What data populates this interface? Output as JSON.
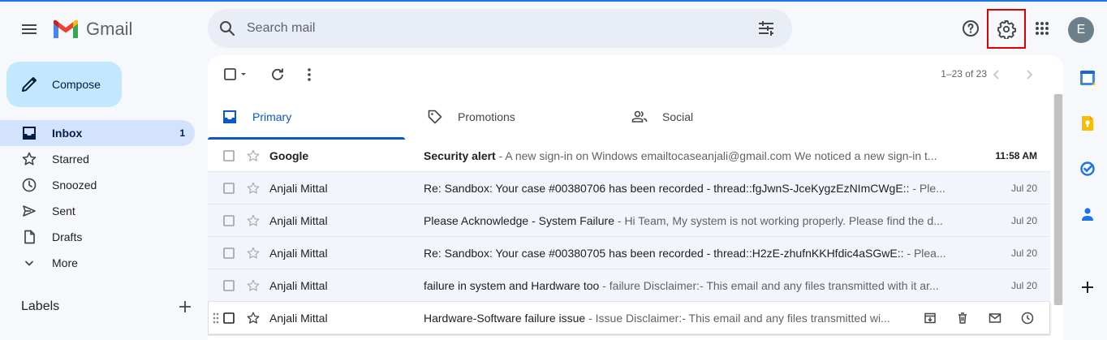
{
  "app": {
    "title": "Gmail"
  },
  "search": {
    "placeholder": "Search mail"
  },
  "account": {
    "initial": "E"
  },
  "compose": {
    "label": "Compose"
  },
  "nav": {
    "items": [
      {
        "label": "Inbox",
        "count": "1",
        "icon": "inbox-icon"
      },
      {
        "label": "Starred",
        "count": "",
        "icon": "star-icon"
      },
      {
        "label": "Snoozed",
        "count": "",
        "icon": "clock-icon"
      },
      {
        "label": "Sent",
        "count": "",
        "icon": "send-icon"
      },
      {
        "label": "Drafts",
        "count": "",
        "icon": "draft-icon"
      },
      {
        "label": "More",
        "count": "",
        "icon": "chevron-down-icon"
      }
    ]
  },
  "labels": {
    "heading": "Labels"
  },
  "toolbar": {
    "pager": "1–23 of 23"
  },
  "tabs": [
    {
      "label": "Primary",
      "icon": "inbox-icon"
    },
    {
      "label": "Promotions",
      "icon": "tag-icon"
    },
    {
      "label": "Social",
      "icon": "people-icon"
    }
  ],
  "emails": [
    {
      "sender": "Google",
      "subject": "Security alert",
      "snippet": " - A new sign-in on Windows emailtocaseanjali@gmail.com We noticed a new sign-in t...",
      "date": "11:58 AM",
      "unread": true
    },
    {
      "sender": "Anjali Mittal",
      "subject": "Re: Sandbox: Your case #00380706 has been recorded - thread::fgJwnS-JceKygzEzNImCWgE::",
      "snippet": " - Ple...",
      "date": "Jul 20",
      "unread": false
    },
    {
      "sender": "Anjali Mittal",
      "subject": "Please Acknowledge - System Failure",
      "snippet": " - Hi Team, My system is not working properly. Please find the d...",
      "date": "Jul 20",
      "unread": false
    },
    {
      "sender": "Anjali Mittal",
      "subject": "Re: Sandbox: Your case #00380705 has been recorded - thread::H2zE-zhufnKKHfdic4aSGwE::",
      "snippet": " - Plea...",
      "date": "Jul 20",
      "unread": false
    },
    {
      "sender": "Anjali Mittal",
      "subject": "failure in system and Hardware too",
      "snippet": " - failure Disclaimer:- This email and any files transmitted with it ar...",
      "date": "Jul 20",
      "unread": false
    },
    {
      "sender": "Anjali Mittal",
      "subject": "Hardware-Software failure issue",
      "snippet": " - Issue Disclaimer:- This email and any files transmitted wi...",
      "date": "",
      "unread": false
    }
  ],
  "colors": {
    "accent": "#0b57d0",
    "compose_bg": "#c2e7ff",
    "active_nav": "#d3e3fd",
    "highlight_box": "#e00000"
  }
}
